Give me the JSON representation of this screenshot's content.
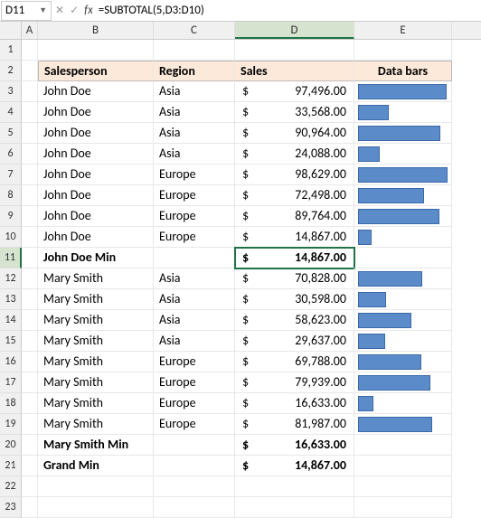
{
  "name_box": "D11",
  "formula": "=SUBTOTAL(5,D3:D10)",
  "columns": [
    "A",
    "B",
    "C",
    "D",
    "E"
  ],
  "active_col": "D",
  "active_row": 11,
  "headers": {
    "b": "Salesperson",
    "c": "Region",
    "d": "Sales",
    "e": "Data bars"
  },
  "chart_data": {
    "type": "bar",
    "title": "Sales Data bars",
    "xlabel": "Salesperson",
    "ylabel": "Sales",
    "categories": [
      "John Doe/Asia",
      "John Doe/Asia",
      "John Doe/Asia",
      "John Doe/Asia",
      "John Doe/Europe",
      "John Doe/Europe",
      "John Doe/Europe",
      "John Doe/Europe",
      "Mary Smith/Asia",
      "Mary Smith/Asia",
      "Mary Smith/Asia",
      "Mary Smith/Asia",
      "Mary Smith/Europe",
      "Mary Smith/Europe",
      "Mary Smith/Europe",
      "Mary Smith/Europe"
    ],
    "values": [
      97496.0,
      33568.0,
      90964.0,
      24088.0,
      98629.0,
      72498.0,
      89764.0,
      14867.0,
      70828.0,
      30598.0,
      58623.0,
      29637.0,
      69788.0,
      79939.0,
      16633.0,
      81987.0
    ],
    "ylim": [
      0,
      98629
    ]
  },
  "rows": [
    {
      "r": 3,
      "b": "John Doe",
      "c": "Asia",
      "dsym": "$",
      "d": "97,496.00",
      "bar": 98.85
    },
    {
      "r": 4,
      "b": "John Doe",
      "c": "Asia",
      "dsym": "$",
      "d": "33,568.00",
      "bar": 34.03
    },
    {
      "r": 5,
      "b": "John Doe",
      "c": "Asia",
      "dsym": "$",
      "d": "90,964.00",
      "bar": 92.23
    },
    {
      "r": 6,
      "b": "John Doe",
      "c": "Asia",
      "dsym": "$",
      "d": "24,088.00",
      "bar": 24.42
    },
    {
      "r": 7,
      "b": "John Doe",
      "c": "Europe",
      "dsym": "$",
      "d": "98,629.00",
      "bar": 100.0
    },
    {
      "r": 8,
      "b": "John Doe",
      "c": "Europe",
      "dsym": "$",
      "d": "72,498.00",
      "bar": 73.51
    },
    {
      "r": 9,
      "b": "John Doe",
      "c": "Europe",
      "dsym": "$",
      "d": "89,764.00",
      "bar": 91.01
    },
    {
      "r": 10,
      "b": "John Doe",
      "c": "Europe",
      "dsym": "$",
      "d": "14,867.00",
      "bar": 15.07
    },
    {
      "r": 11,
      "b": "John Doe Min",
      "c": "",
      "dsym": "$",
      "d": "14,867.00",
      "bar": null,
      "bold": true,
      "selected": true
    },
    {
      "r": 12,
      "b": "Mary Smith",
      "c": "Asia",
      "dsym": "$",
      "d": "70,828.00",
      "bar": 71.81
    },
    {
      "r": 13,
      "b": "Mary Smith",
      "c": "Asia",
      "dsym": "$",
      "d": "30,598.00",
      "bar": 31.02
    },
    {
      "r": 14,
      "b": "Mary Smith",
      "c": "Asia",
      "dsym": "$",
      "d": "58,623.00",
      "bar": 59.44
    },
    {
      "r": 15,
      "b": "Mary Smith",
      "c": "Asia",
      "dsym": "$",
      "d": "29,637.00",
      "bar": 30.05
    },
    {
      "r": 16,
      "b": "Mary Smith",
      "c": "Europe",
      "dsym": "$",
      "d": "69,788.00",
      "bar": 70.76
    },
    {
      "r": 17,
      "b": "Mary Smith",
      "c": "Europe",
      "dsym": "$",
      "d": "79,939.00",
      "bar": 81.05
    },
    {
      "r": 18,
      "b": "Mary Smith",
      "c": "Europe",
      "dsym": "$",
      "d": "16,633.00",
      "bar": 16.86
    },
    {
      "r": 19,
      "b": "Mary Smith",
      "c": "Europe",
      "dsym": "$",
      "d": "81,987.00",
      "bar": 83.13
    },
    {
      "r": 20,
      "b": "Mary Smith Min",
      "c": "",
      "dsym": "$",
      "d": "16,633.00",
      "bar": null,
      "bold": true
    },
    {
      "r": 21,
      "b": "Grand Min",
      "c": "",
      "dsym": "$",
      "d": "14,867.00",
      "bar": null,
      "bold": true
    }
  ]
}
